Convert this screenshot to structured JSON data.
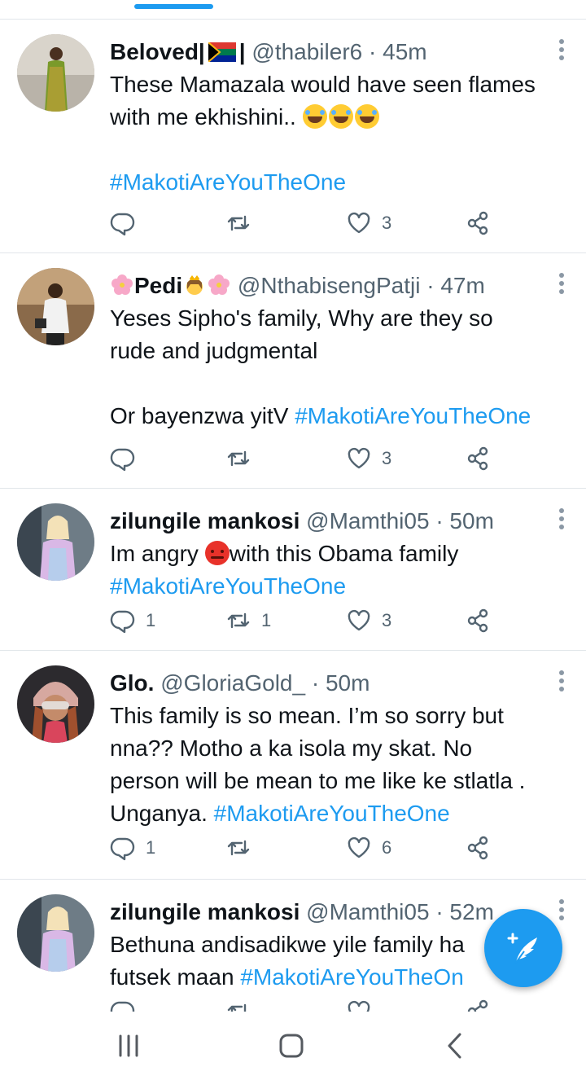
{
  "feed": {
    "tweets": [
      {
        "name": "Beloved|",
        "handle": "@thabiler6",
        "time": "· 45m",
        "text_line1": "These Mamazala would have seen flames",
        "text_line2": "with me ekhishini..",
        "hashtag": "#MakotiAreYouTheOne",
        "reply_count": "",
        "retweet_count": "",
        "like_count": "3"
      },
      {
        "name": "Pedi",
        "handle": "@NthabisengPatji",
        "time": "· 47m",
        "text_line1": "Yeses Sipho's family, Why are they so",
        "text_line2": "rude and judgmental",
        "text_line3": "Or bayenzwa yitV",
        "hashtag": "#MakotiAreYouTheOne",
        "reply_count": "",
        "retweet_count": "",
        "like_count": "3"
      },
      {
        "name": "zilungile mankosi",
        "handle": "@Mamthi05",
        "time": "· 50m",
        "text_line1a": "Im angry",
        "text_line1b": "with this Obama family",
        "hashtag": "#MakotiAreYouTheOne",
        "reply_count": "1",
        "retweet_count": "1",
        "like_count": "3"
      },
      {
        "name": "Glo.",
        "handle": "@GloriaGold_",
        "time": "· 50m",
        "text_line1": "This family is so mean. I’m so sorry but",
        "text_line2": "nna?? Motho a ka isola my skat. No",
        "text_line3": "person will be mean to me like ke stlatla .",
        "text_line4": "Unganya.",
        "hashtag": "#MakotiAreYouTheOne",
        "reply_count": "1",
        "retweet_count": "",
        "like_count": "6"
      },
      {
        "name": "zilungile mankosi",
        "handle": "@Mamthi05",
        "time": "· 52m",
        "text_line1": "Bethuna andisadikwe yile family ha",
        "text_line2": "futsek maan",
        "hashtag": "#MakotiAreYouTheOn",
        "reply_count": "",
        "retweet_count": "",
        "like_count": ""
      }
    ]
  },
  "icons": {
    "reply": "reply-icon",
    "retweet": "retweet-icon",
    "like": "heart-icon",
    "share": "share-icon",
    "more": "more-vertical-icon",
    "compose": "compose-tweet-icon",
    "nav_recent": "recent-apps-icon",
    "nav_home": "home-icon",
    "nav_back": "back-icon"
  },
  "colors": {
    "accent": "#1d9bf0",
    "text": "#0f1419",
    "muted": "#536471",
    "divider": "#e1e6ea"
  }
}
